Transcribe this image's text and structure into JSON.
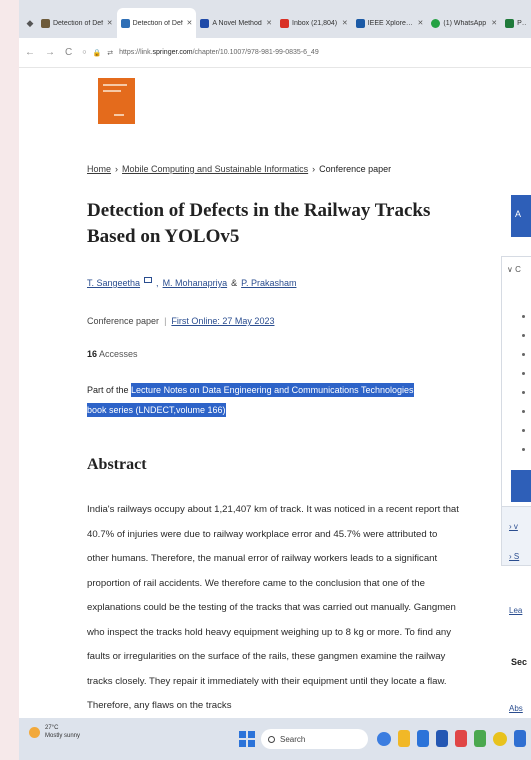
{
  "browser": {
    "tabs": [
      {
        "label": "Detection of Def",
        "color": "#6e5b3a",
        "active": false
      },
      {
        "label": "Detection of Def",
        "color": "#2f6fb6",
        "active": true
      },
      {
        "label": "A Novel Method",
        "color": "#1f4aa8",
        "active": false
      },
      {
        "label": "Inbox (21,804)",
        "color": "#d93025",
        "active": false
      },
      {
        "label": "IEEE Xplore - Co",
        "color": "#1b5aa6",
        "active": false
      },
      {
        "label": "(1) WhatsApp",
        "color": "#25a244",
        "active": false
      },
      {
        "label": "Perfe",
        "color": "#1f7a3a",
        "active": false
      }
    ],
    "url_prefix": "https://link.",
    "url_domain": "springer.com",
    "url_path": "/chapter/10.1007/978-981-99-0835-6_49"
  },
  "article": {
    "breadcrumb": [
      "Home",
      "Mobile Computing and Sustainable Informatics",
      "Conference paper"
    ],
    "title": "Detection of Defects in the Railway Tracks Based on YOLOv5",
    "authors": [
      "T. Sangeetha",
      "M. Mohanapriya",
      "P. Prakasham"
    ],
    "author_amp": "&",
    "paper_type": "Conference paper",
    "first_online": "First Online: 27 May 2023",
    "accesses_count": "16",
    "accesses_label": "Accesses",
    "part_of_prefix": "Part of the",
    "series_link": "Lecture Notes on Data Engineering and Communications Technologies book series (LNDECT,volume 166)",
    "abstract_heading": "Abstract",
    "abstract_text": "India's railways occupy about 1,21,407 km of track. It was noticed in a recent report that 40.7% of injuries were due to railway workplace error and 45.7% were attributed to other humans. Therefore, the manual error of railway workers leads to a significant proportion of rail accidents. We therefore came to the conclusion that one of the explanations could be the testing of the tracks that was carried out manually. Gangmen who inspect the tracks hold heavy equipment weighing up to 8 kg or more. To find any faults or irregularities on the surface of the rails, these gangmen examine the railway tracks closely. They repair it immediately with their equipment until they locate a flaw. Therefore, any flaws on the tracks"
  },
  "sidebar": {
    "btn_label": "A",
    "panel_top": "∨ C",
    "link1": "› v",
    "link2": "› S",
    "link3": "Lea",
    "section": "Sec",
    "link4": "Abs"
  },
  "taskbar": {
    "temperature": "27°C",
    "weather": "Mostly sunny",
    "search_label": "Search"
  },
  "colors": {
    "accent": "#2e5fb8",
    "highlight": "#2d63c8",
    "cover": "#e46b1c"
  }
}
